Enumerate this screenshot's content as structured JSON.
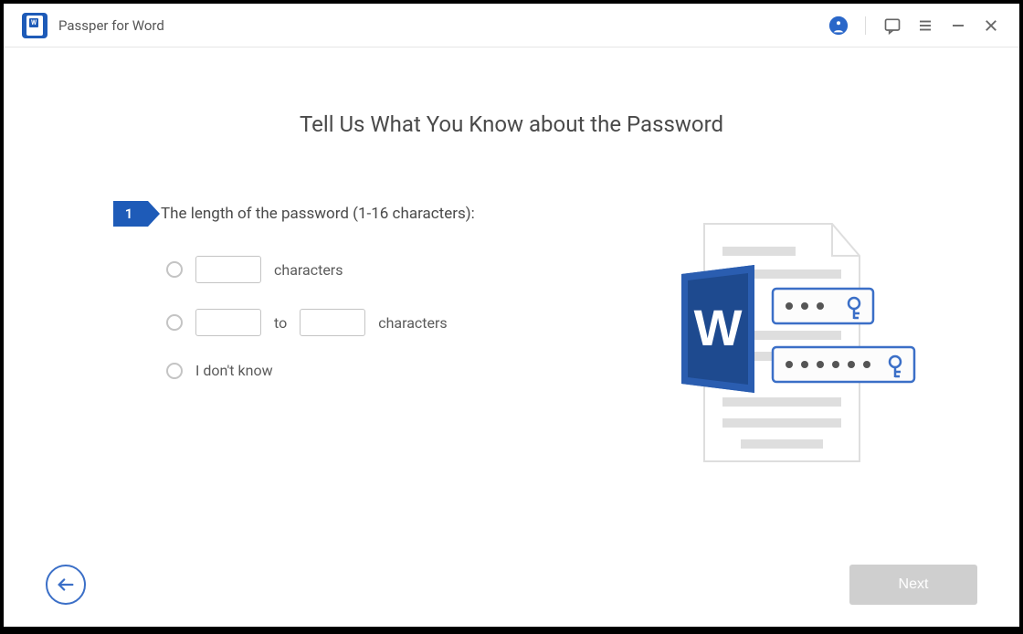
{
  "app": {
    "title": "Passper for Word"
  },
  "page": {
    "title": "Tell Us What You Know about the Password",
    "step_number": "1",
    "question": "The length of the password (1-16 characters):",
    "options": {
      "exact": {
        "suffix": "characters"
      },
      "range": {
        "connector": "to",
        "suffix": "characters"
      },
      "unknown": {
        "label": "I don't know"
      }
    }
  },
  "footer": {
    "next_label": "Next"
  }
}
